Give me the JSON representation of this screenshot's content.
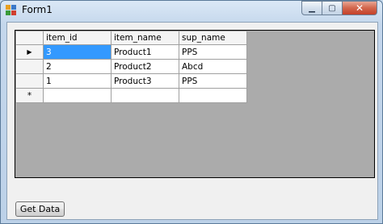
{
  "window": {
    "title": "Form1"
  },
  "grid": {
    "columns": [
      "item_id",
      "item_name",
      "sup_name"
    ],
    "rows": [
      {
        "marker": "▶",
        "cells": [
          "3",
          "Product1",
          "PPS"
        ]
      },
      {
        "marker": "",
        "cells": [
          "2",
          "Product2",
          "Abcd"
        ]
      },
      {
        "marker": "",
        "cells": [
          "1",
          "Product3",
          "PPS"
        ]
      },
      {
        "marker": "*",
        "cells": [
          "",
          "",
          ""
        ]
      }
    ]
  },
  "button": {
    "label": "Get Data"
  },
  "colors": {
    "selection": "#3399ff",
    "grid_background": "#ababab"
  }
}
